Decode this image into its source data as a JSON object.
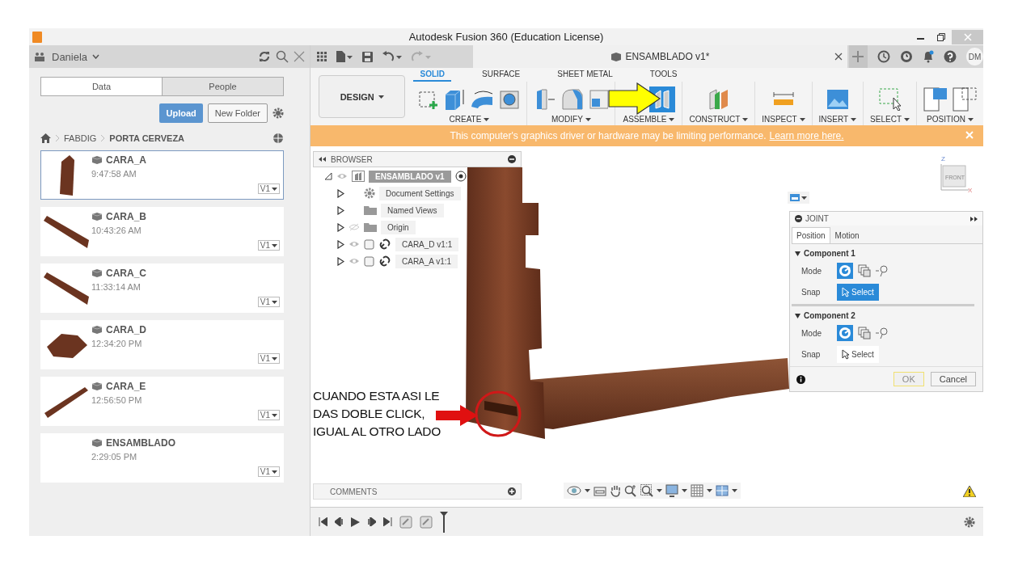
{
  "window": {
    "title": "Autodesk Fusion 360 (Education License)"
  },
  "data_panel": {
    "user": "Daniela",
    "tabs": [
      {
        "label": "Data",
        "selected": true
      },
      {
        "label": "People",
        "selected": false
      }
    ],
    "upload_button": "Upload",
    "new_folder_button": "New Folder",
    "breadcrumb": [
      "FABDIG",
      "PORTA CERVEZA"
    ],
    "files": [
      {
        "name": "CARA_A",
        "time": "9:47:58 AM",
        "version": "V1",
        "selected": true,
        "kind": "panel"
      },
      {
        "name": "CARA_B",
        "time": "10:43:26 AM",
        "version": "V1",
        "selected": false,
        "kind": "plank"
      },
      {
        "name": "CARA_C",
        "time": "11:33:14 AM",
        "version": "V1",
        "selected": false,
        "kind": "plank"
      },
      {
        "name": "CARA_D",
        "time": "12:34:20 PM",
        "version": "V1",
        "selected": false,
        "kind": "board"
      },
      {
        "name": "CARA_E",
        "time": "12:56:50 PM",
        "version": "V1",
        "selected": false,
        "kind": "rod"
      },
      {
        "name": "ENSAMBLADO",
        "time": "2:29:05 PM",
        "version": "V1",
        "selected": false,
        "kind": "empty"
      }
    ]
  },
  "document_tab": {
    "title": "ENSAMBLADO v1*"
  },
  "avatar": "DM",
  "toolbar": {
    "workspace": "DESIGN",
    "tabs": [
      {
        "label": "SOLID",
        "selected": true
      },
      {
        "label": "SURFACE",
        "selected": false
      },
      {
        "label": "SHEET METAL",
        "selected": false
      },
      {
        "label": "TOOLS",
        "selected": false
      }
    ],
    "groups": [
      {
        "label": "CREATE",
        "kind": "create"
      },
      {
        "label": "MODIFY",
        "kind": "modify"
      },
      {
        "label": "ASSEMBLE",
        "kind": "assemble"
      },
      {
        "label": "CONSTRUCT",
        "kind": "construct"
      },
      {
        "label": "INSPECT",
        "kind": "inspect"
      },
      {
        "label": "INSERT",
        "kind": "insert"
      },
      {
        "label": "SELECT",
        "kind": "select"
      },
      {
        "label": "POSITION",
        "kind": "position"
      }
    ]
  },
  "banner": {
    "message": "This computer's graphics driver or hardware may be limiting performance.",
    "link": "Learn more here."
  },
  "browser": {
    "title": "BROWSER",
    "root": {
      "label": "ENSAMBLADO v1",
      "expanded": true
    },
    "items": [
      {
        "label": "Document Settings",
        "kind": "settings"
      },
      {
        "label": "Named Views",
        "kind": "folder"
      },
      {
        "label": "Origin",
        "kind": "folder",
        "visible": false
      },
      {
        "label": "CARA_D v1:1",
        "kind": "component",
        "visible": true
      },
      {
        "label": "CARA_A v1:1",
        "kind": "component",
        "visible": true
      }
    ]
  },
  "view_cube": {
    "face": "FRONT",
    "axes": [
      "Z",
      "X"
    ]
  },
  "joint_panel": {
    "title": "JOINT",
    "tabs": [
      {
        "label": "Position",
        "selected": true
      },
      {
        "label": "Motion",
        "selected": false
      }
    ],
    "sections": [
      {
        "title": "Component 1",
        "mode_label": "Mode",
        "snap_label": "Snap",
        "select_label": "Select",
        "select_active": true
      },
      {
        "title": "Component 2",
        "mode_label": "Mode",
        "snap_label": "Snap",
        "select_label": "Select",
        "select_active": false
      }
    ],
    "ok_button": "OK",
    "ok_disabled": true,
    "cancel_button": "Cancel"
  },
  "annotation": {
    "lines": [
      "CUANDO ESTA ASI LE",
      "DAS DOBLE CLICK,",
      "IGUAL AL OTRO LADO"
    ]
  },
  "comments": {
    "title": "COMMENTS"
  }
}
